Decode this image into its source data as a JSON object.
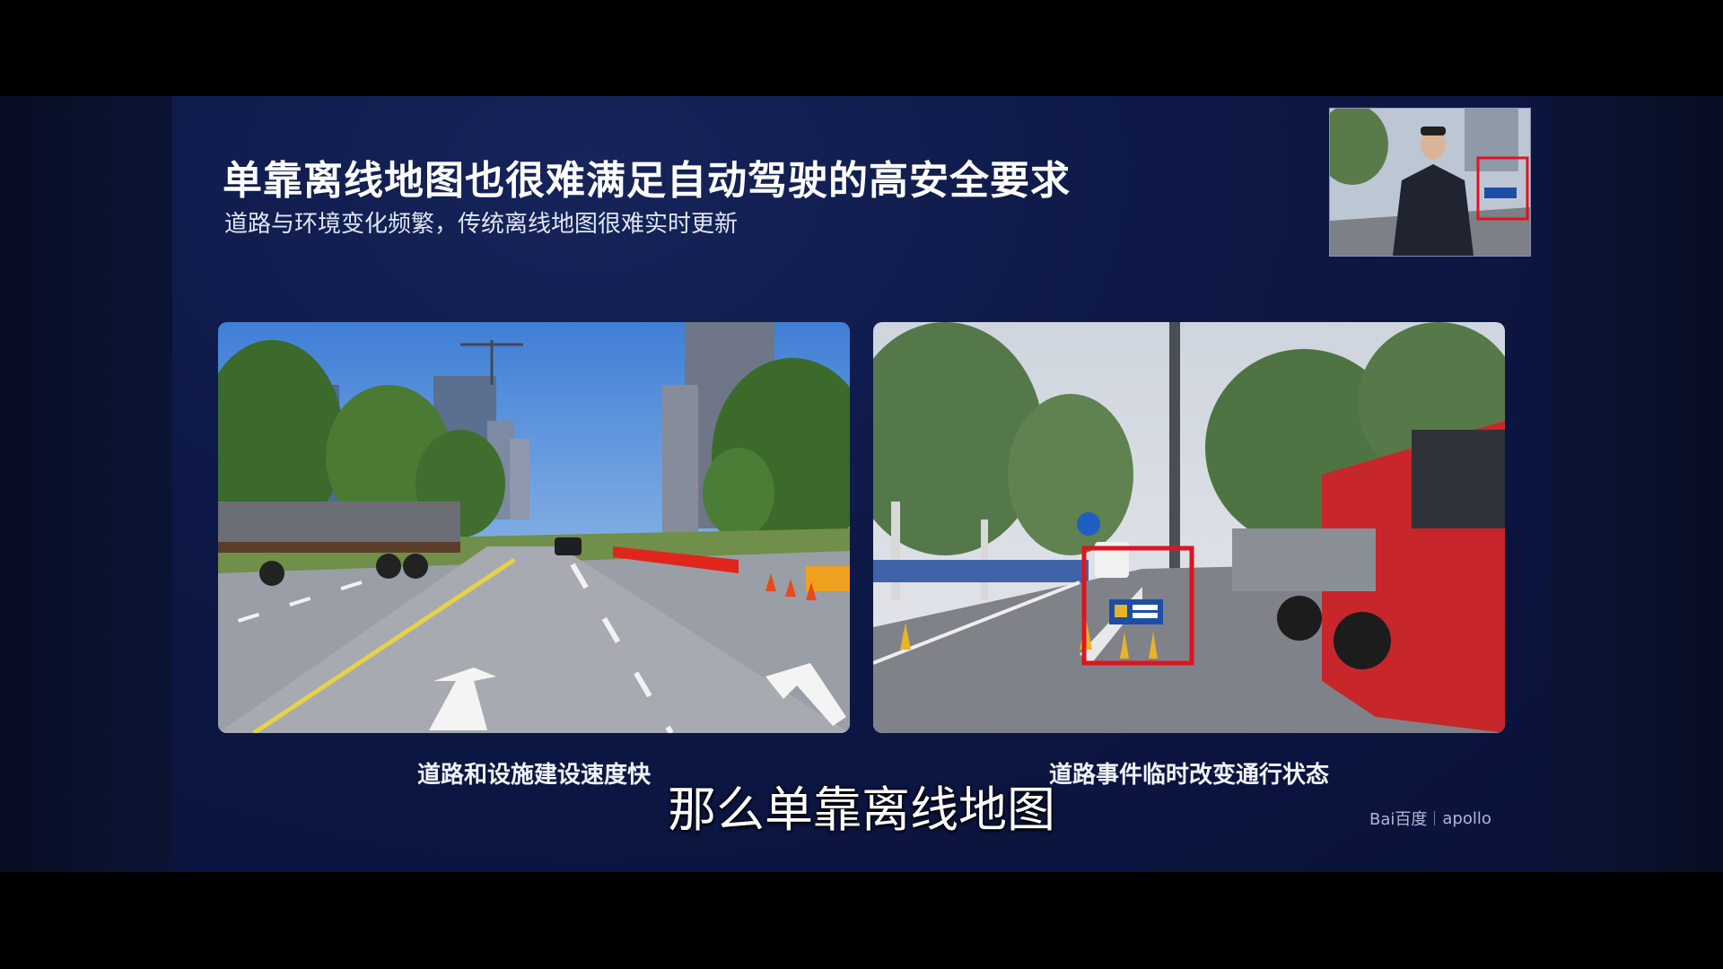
{
  "slide": {
    "title": "单靠离线地图也很难满足自动驾驶的高安全要求",
    "subtitle": "道路与环境变化频繁，传统离线地图很难实时更新"
  },
  "photos": [
    {
      "caption": "道路和设施建设速度快"
    },
    {
      "caption": "道路事件临时改变通行状态"
    }
  ],
  "brand": {
    "baidu": "Bai百度",
    "apollo": "apollo"
  },
  "video_subtitle": "那么单靠离线地图",
  "colors": {
    "slide_bg": "#0d1846",
    "highlight_box": "#e0141e"
  }
}
